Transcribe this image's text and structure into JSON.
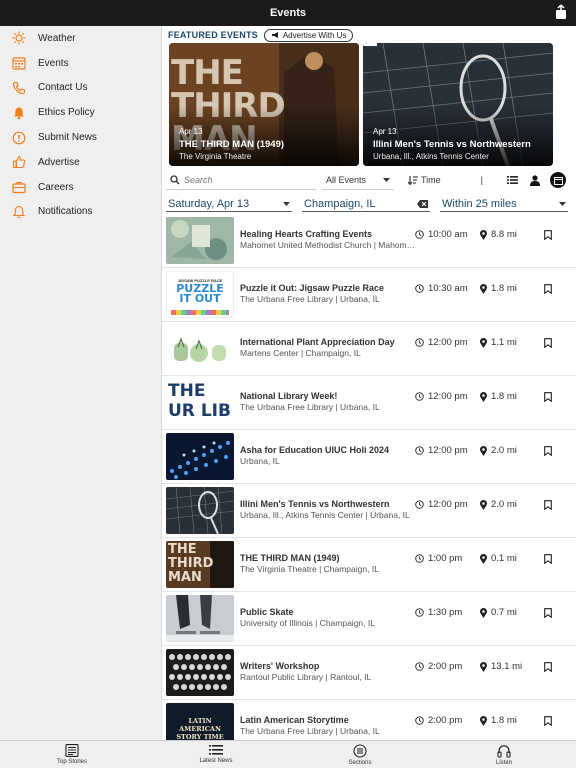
{
  "header": {
    "title": "Events"
  },
  "sidebar": {
    "items": [
      {
        "label": "Weather",
        "icon": "sun-icon"
      },
      {
        "label": "Events",
        "icon": "calendar-icon"
      },
      {
        "label": "Contact Us",
        "icon": "phone-icon"
      },
      {
        "label": "Ethics Policy",
        "icon": "bell-icon"
      },
      {
        "label": "Submit News",
        "icon": "alert-icon"
      },
      {
        "label": "Advertise",
        "icon": "thumbs-up-icon"
      },
      {
        "label": "Careers",
        "icon": "briefcase-icon"
      },
      {
        "label": "Notifications",
        "icon": "bell-outline-icon"
      }
    ]
  },
  "featured": {
    "heading": "FEATURED EVENTS",
    "advertise_label": "Advertise With Us",
    "items": [
      {
        "date": "Apr 13",
        "name": "THE THIRD MAN (1949)",
        "venue": "The Virginia Theatre",
        "poster_text": "THE THIRD MAN"
      },
      {
        "date": "Apr 13",
        "name": "Illini Men's Tennis vs Northwestern",
        "venue": "Urbana, Ill., Atkins Tennis Center"
      }
    ]
  },
  "search": {
    "placeholder": "Search",
    "category": "All Events",
    "sort_label": "Time"
  },
  "filters": {
    "date": "Saturday, Apr 13",
    "location": "Champaign, IL",
    "radius": "Within 25 miles"
  },
  "events": [
    {
      "name": "Healing Hearts Crafting Events",
      "venue": "Mahomet United Methodist Church | Mahomet, IL",
      "time": "10:00 am",
      "distance": "8.8 mi"
    },
    {
      "name": "Puzzle it Out: Jigsaw Puzzle Race",
      "venue": "The Urbana Free Library | Urbana, IL",
      "time": "10:30 am",
      "distance": "1.8 mi",
      "thumb_text": "PUZZLE IT OUT",
      "thumb_sub": "JIGSAW PUZZLE RACE"
    },
    {
      "name": "International Plant Appreciation Day",
      "venue": "Martens Center | Champaign, IL",
      "time": "12:00 pm",
      "distance": "1.1 mi"
    },
    {
      "name": "National Library Week!",
      "venue": "The Urbana Free Library | Urbana, IL",
      "time": "12:00 pm",
      "distance": "1.8 mi",
      "thumb_text": "THE UR LIB"
    },
    {
      "name": "Asha for Education UIUC Holi 2024",
      "venue": "Urbana, IL",
      "time": "12:00 pm",
      "distance": "2.0 mi"
    },
    {
      "name": "Illini Men's Tennis vs Northwestern",
      "venue": "Urbana, Ill., Atkins Tennis Center | Urbana, IL",
      "time": "12:00 pm",
      "distance": "2.0 mi"
    },
    {
      "name": "THE THIRD MAN (1949)",
      "venue": "The Virginia Theatre | Champaign, IL",
      "time": "1:00 pm",
      "distance": "0.1 mi",
      "thumb_text": "THE THIRD MAN"
    },
    {
      "name": "Public Skate",
      "venue": "University of Illinois | Champaign, IL",
      "time": "1:30 pm",
      "distance": "0.7 mi"
    },
    {
      "name": "Writers' Workshop",
      "venue": "Rantoul Public Library | Rantoul, IL",
      "time": "2:00 pm",
      "distance": "13.1 mi"
    },
    {
      "name": "Latin American Storytime",
      "venue": "The Urbana Free Library | Urbana, IL",
      "time": "2:00 pm",
      "distance": "1.8 mi",
      "thumb_text": "LATIN AMERICAN STORY TIME"
    }
  ],
  "tabs": [
    {
      "label": "Top Stories",
      "icon": "newspaper-icon"
    },
    {
      "label": "Latest News",
      "icon": "list-icon"
    },
    {
      "label": "Sections",
      "icon": "sections-icon"
    },
    {
      "label": "Listen",
      "icon": "headphones-icon"
    }
  ],
  "colors": {
    "accent": "#f07d1a",
    "title_blue": "#1d4a6e",
    "topbar": "#1a1a1a"
  }
}
